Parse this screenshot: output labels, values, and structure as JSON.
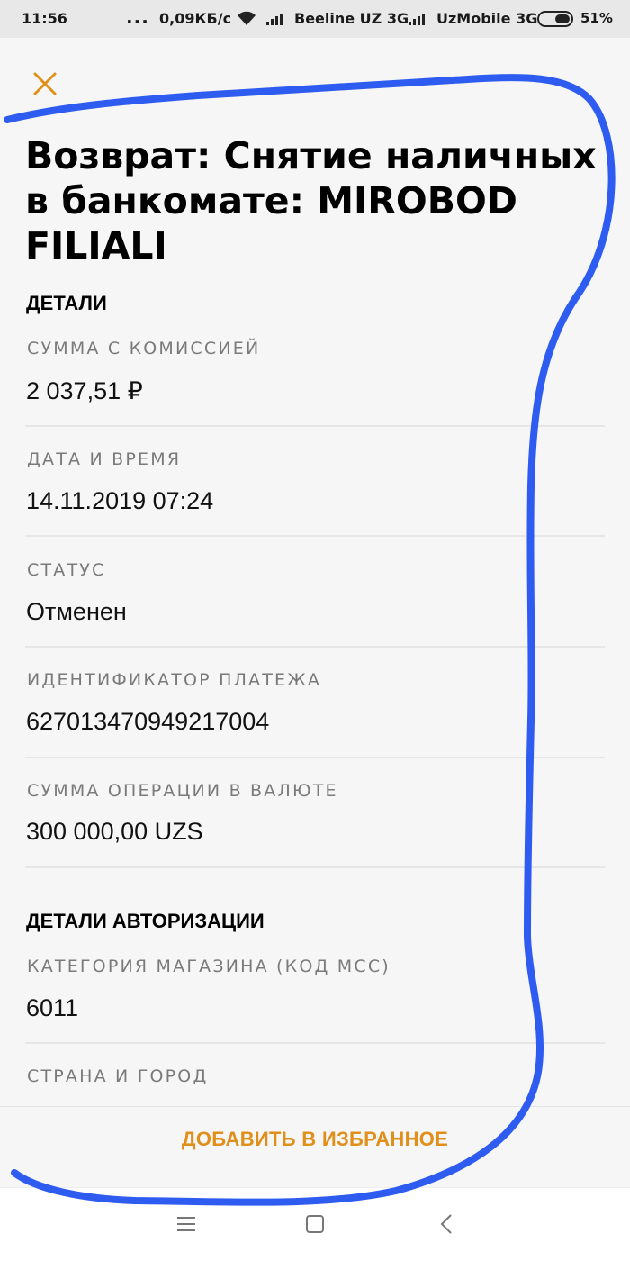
{
  "status_bar": {
    "time": "11:56",
    "dots": "...",
    "speed": "0,09КБ/с",
    "operator1": "Beeline UZ 3G",
    "operator2": "UzMobile 3G",
    "battery": "51%"
  },
  "header": {
    "close_icon": "close-icon",
    "title": "Возврат: Снятие наличных в банкомате: MIROBOD FILIALI"
  },
  "details": {
    "heading": "ДЕТАЛИ",
    "fields": [
      {
        "label": "СУММА С КОМИССИЕЙ",
        "value": "2 037,51 ₽"
      },
      {
        "label": "ДАТА И ВРЕМЯ",
        "value": "14.11.2019 07:24"
      },
      {
        "label": "СТАТУС",
        "value": "Отменен"
      },
      {
        "label": "ИДЕНТИФИКАТОР ПЛАТЕЖА",
        "value": "627013470949217004"
      },
      {
        "label": "СУММА ОПЕРАЦИИ В ВАЛЮТЕ",
        "value": "300 000,00 UZS"
      }
    ]
  },
  "auth_details": {
    "heading": "ДЕТАЛИ АВТОРИЗАЦИИ",
    "fields": [
      {
        "label": "КАТЕГОРИЯ МАГАЗИНА (КОД MCC)",
        "value": "6011"
      },
      {
        "label": "СТРАНА И ГОРОД",
        "value": ""
      }
    ]
  },
  "footer": {
    "favorite_label": "ДОБАВИТЬ В ИЗБРАННОЕ"
  },
  "navbar": {
    "icons": [
      "menu-icon",
      "home-icon",
      "back-icon"
    ]
  },
  "colors": {
    "accent": "#e0901a",
    "annotation": "#2f5cf0",
    "label": "#7a7a7a",
    "background": "#f6f6f7"
  }
}
